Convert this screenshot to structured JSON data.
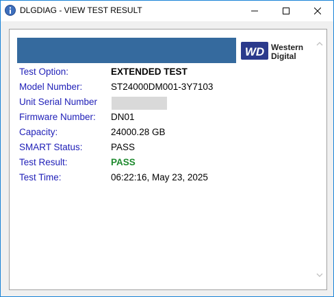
{
  "window": {
    "title": "DLGDIAG - VIEW TEST RESULT"
  },
  "logo": {
    "mark": "WD",
    "line1": "Western",
    "line2": "Digital"
  },
  "fields": [
    {
      "label": "Test Option:",
      "value": "EXTENDED TEST"
    },
    {
      "label": "Model Number:",
      "value": "ST24000DM001-3Y7103"
    },
    {
      "label": "Unit Serial Number",
      "value": ""
    },
    {
      "label": "Firmware Number:",
      "value": "DN01"
    },
    {
      "label": "Capacity:",
      "value": "24000.28 GB"
    },
    {
      "label": "SMART Status:",
      "value": "PASS"
    },
    {
      "label": "Test Result:",
      "value": "PASS"
    },
    {
      "label": "Test Time:",
      "value": "06:22:16, May 23, 2025"
    }
  ],
  "colors": {
    "label": "#2020b8",
    "pass": "#1e8a2e",
    "banner": "#356a9e",
    "logo_box": "#2b3a8c"
  }
}
